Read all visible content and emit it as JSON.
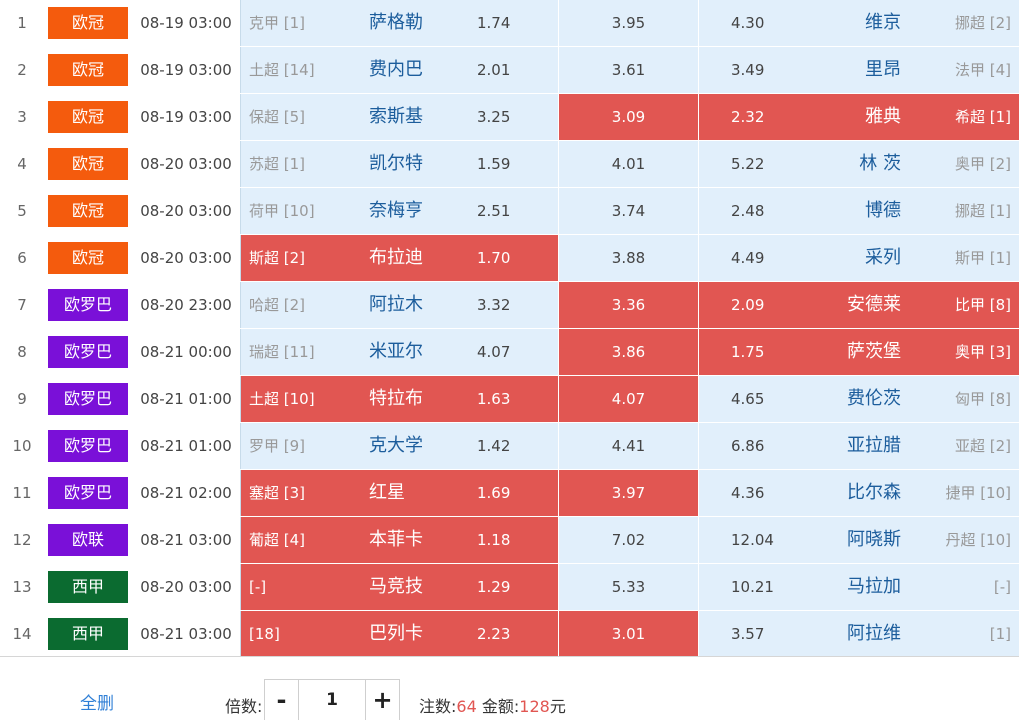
{
  "colors": {
    "ou_guan": "#f45b0d",
    "ou_luo_ba": "#7a10d8",
    "ou_lian": "#7a10d8",
    "xi_jia": "#0b6b30",
    "selected": "#e15652",
    "cell_bg": "#e1effb"
  },
  "matches": [
    {
      "idx": "1",
      "comp": "欧冠",
      "comp_color": "#f45b0d",
      "time": "08-19 03:00",
      "home_league": "克甲 [1]",
      "home": "萨格勒",
      "home_odds": "1.74",
      "draw_odds": "3.95",
      "away_odds": "4.30",
      "away": "维京",
      "away_league": "挪超 [2]",
      "sel_home": false,
      "sel_draw": false,
      "sel_away": false
    },
    {
      "idx": "2",
      "comp": "欧冠",
      "comp_color": "#f45b0d",
      "time": "08-19 03:00",
      "home_league": "土超 [14]",
      "home": "费内巴",
      "home_odds": "2.01",
      "draw_odds": "3.61",
      "away_odds": "3.49",
      "away": "里昂",
      "away_league": "法甲 [4]",
      "sel_home": false,
      "sel_draw": false,
      "sel_away": false
    },
    {
      "idx": "3",
      "comp": "欧冠",
      "comp_color": "#f45b0d",
      "time": "08-19 03:00",
      "home_league": "保超 [5]",
      "home": "索斯基",
      "home_odds": "3.25",
      "draw_odds": "3.09",
      "away_odds": "2.32",
      "away": "雅典",
      "away_league": "希超 [1]",
      "sel_home": false,
      "sel_draw": true,
      "sel_away": true
    },
    {
      "idx": "4",
      "comp": "欧冠",
      "comp_color": "#f45b0d",
      "time": "08-20 03:00",
      "home_league": "苏超 [1]",
      "home": "凯尔特",
      "home_odds": "1.59",
      "draw_odds": "4.01",
      "away_odds": "5.22",
      "away": "林 茨",
      "away_league": "奥甲 [2]",
      "sel_home": false,
      "sel_draw": false,
      "sel_away": false
    },
    {
      "idx": "5",
      "comp": "欧冠",
      "comp_color": "#f45b0d",
      "time": "08-20 03:00",
      "home_league": "荷甲 [10]",
      "home": "奈梅亨",
      "home_odds": "2.51",
      "draw_odds": "3.74",
      "away_odds": "2.48",
      "away": "博德",
      "away_league": "挪超 [1]",
      "sel_home": false,
      "sel_draw": false,
      "sel_away": false
    },
    {
      "idx": "6",
      "comp": "欧冠",
      "comp_color": "#f45b0d",
      "time": "08-20 03:00",
      "home_league": "斯超 [2]",
      "home": "布拉迪",
      "home_odds": "1.70",
      "draw_odds": "3.88",
      "away_odds": "4.49",
      "away": "采列",
      "away_league": "斯甲 [1]",
      "sel_home": true,
      "sel_draw": false,
      "sel_away": false
    },
    {
      "idx": "7",
      "comp": "欧罗巴",
      "comp_color": "#7a10d8",
      "time": "08-20 23:00",
      "home_league": "哈超 [2]",
      "home": "阿拉木",
      "home_odds": "3.32",
      "draw_odds": "3.36",
      "away_odds": "2.09",
      "away": "安德莱",
      "away_league": "比甲 [8]",
      "sel_home": false,
      "sel_draw": true,
      "sel_away": true
    },
    {
      "idx": "8",
      "comp": "欧罗巴",
      "comp_color": "#7a10d8",
      "time": "08-21 00:00",
      "home_league": "瑞超 [11]",
      "home": "米亚尔",
      "home_odds": "4.07",
      "draw_odds": "3.86",
      "away_odds": "1.75",
      "away": "萨茨堡",
      "away_league": "奥甲 [3]",
      "sel_home": false,
      "sel_draw": true,
      "sel_away": true
    },
    {
      "idx": "9",
      "comp": "欧罗巴",
      "comp_color": "#7a10d8",
      "time": "08-21 01:00",
      "home_league": "土超 [10]",
      "home": "特拉布",
      "home_odds": "1.63",
      "draw_odds": "4.07",
      "away_odds": "4.65",
      "away": "费伦茨",
      "away_league": "匈甲 [8]",
      "sel_home": true,
      "sel_draw": true,
      "sel_away": false
    },
    {
      "idx": "10",
      "comp": "欧罗巴",
      "comp_color": "#7a10d8",
      "time": "08-21 01:00",
      "home_league": "罗甲 [9]",
      "home": "克大学",
      "home_odds": "1.42",
      "draw_odds": "4.41",
      "away_odds": "6.86",
      "away": "亚拉腊",
      "away_league": "亚超 [2]",
      "sel_home": false,
      "sel_draw": false,
      "sel_away": false
    },
    {
      "idx": "11",
      "comp": "欧罗巴",
      "comp_color": "#7a10d8",
      "time": "08-21 02:00",
      "home_league": "塞超 [3]",
      "home": "红星",
      "home_odds": "1.69",
      "draw_odds": "3.97",
      "away_odds": "4.36",
      "away": "比尔森",
      "away_league": "捷甲 [10]",
      "sel_home": true,
      "sel_draw": true,
      "sel_away": false
    },
    {
      "idx": "12",
      "comp": "欧联",
      "comp_color": "#7a10d8",
      "time": "08-21 03:00",
      "home_league": "葡超 [4]",
      "home": "本菲卡",
      "home_odds": "1.18",
      "draw_odds": "7.02",
      "away_odds": "12.04",
      "away": "阿晓斯",
      "away_league": "丹超 [10]",
      "sel_home": true,
      "sel_draw": false,
      "sel_away": false
    },
    {
      "idx": "13",
      "comp": "西甲",
      "comp_color": "#0b6b30",
      "time": "08-20 03:00",
      "home_league": "[-]",
      "home": "马竞技",
      "home_odds": "1.29",
      "draw_odds": "5.33",
      "away_odds": "10.21",
      "away": "马拉加",
      "away_league": "[-]",
      "sel_home": true,
      "sel_draw": false,
      "sel_away": false
    },
    {
      "idx": "14",
      "comp": "西甲",
      "comp_color": "#0b6b30",
      "time": "08-21 03:00",
      "home_league": "[18]",
      "home": "巴列卡",
      "home_odds": "2.23",
      "draw_odds": "3.01",
      "away_odds": "3.57",
      "away": "阿拉维",
      "away_league": "[1]",
      "sel_home": true,
      "sel_draw": true,
      "sel_away": false
    }
  ],
  "footer": {
    "clear_label": "全删",
    "multiplier_label": "倍数:",
    "minus_label": "-",
    "multiplier_value": "1",
    "plus_label": "+",
    "bets_label": "注数:",
    "bets_value": "64",
    "amount_label": "金额:",
    "amount_value": "128",
    "amount_unit": "元"
  }
}
